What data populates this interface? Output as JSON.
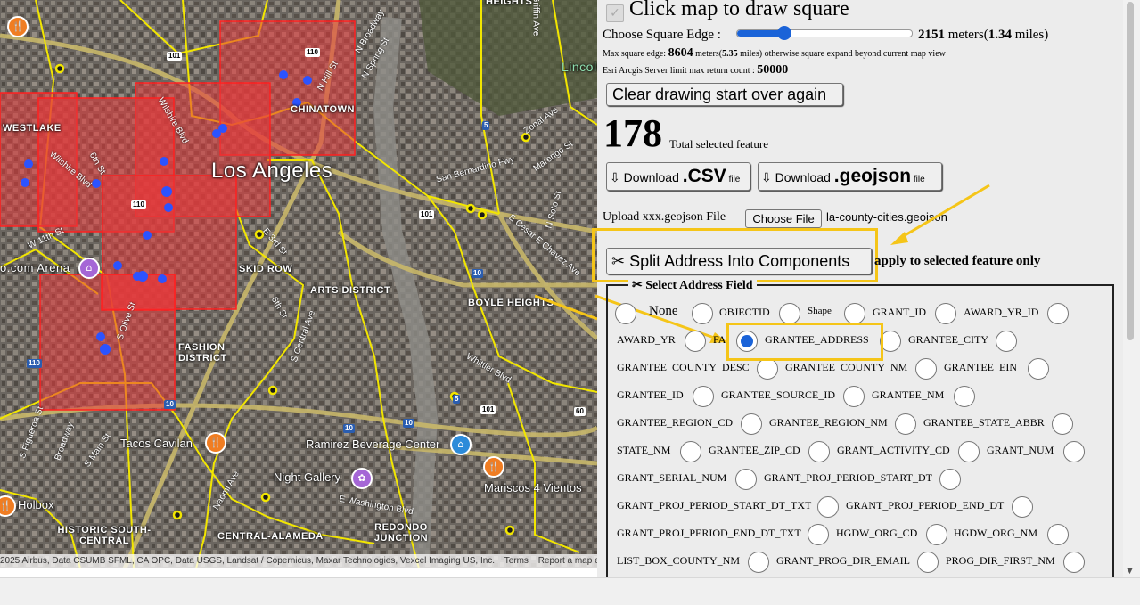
{
  "map": {
    "labels": {
      "heights": "HEIGHTS",
      "westlake": "WESTLAKE",
      "chinatown": "CHINATOWN",
      "los_angeles": "Los Angeles",
      "skid_row": "SKID ROW",
      "arts_district": "ARTS DISTRICT",
      "boyle_heights": "BOYLE HEIGHTS",
      "fashion_district": "FASHION DISTRICT",
      "historic_south_central": "HISTORIC SOUTH-CENTRAL",
      "central_alameda": "CENTRAL-ALAMEDA",
      "redondo_junction": "REDONDO JUNCTION",
      "lincoln": "Lincoln",
      "arena": "o.com Arena"
    },
    "streets": {
      "griffin": "Griffin Ave",
      "broadway": "N Broadway",
      "spring": "N Spring St",
      "hill": "N Hill St",
      "zonal": "Zonal Ave",
      "marengo": "Marengo St",
      "san_bernardino": "San Bernardino Fwy",
      "soto": "N Soto St",
      "cesar": "E Cesar E Chavez Ave",
      "wilshire": "Wilshire Blvd",
      "sixth": "6th St",
      "w11th": "W 11th St",
      "e3rd": "E 3rd St",
      "e6th": "6th St",
      "e4th": "E 4th St",
      "central": "S Central Ave",
      "whittier": "Whittier Blvd",
      "washington": "E Washington Blvd",
      "naomi": "Naomi Ave",
      "broadway_s": "Broadway",
      "main": "S Main St",
      "olive": "S Olive St",
      "figueroa": "S Figueroa St",
      "wilshire2": "Wilshire Blvd"
    },
    "pois": {
      "tacos": "Tacos Cavilan",
      "ramirez": "Ramirez Beverage Center",
      "night_gallery": "Night Gallery",
      "mariscos": "Mariscos 4 Vientos",
      "holbox": "Holbox"
    },
    "shields": [
      "101",
      "110",
      "110",
      "101",
      "10",
      "5",
      "101",
      "10",
      "5",
      "110",
      "60",
      "10",
      "10"
    ],
    "attribution": {
      "text": "2025 Airbus, Data CSUMB SFML, CA OPC, Data USGS, Landsat / Copernicus, Maxar Technologies, Vexcel Imaging US, Inc.",
      "terms": "Terms",
      "report": "Report a map error"
    },
    "colors": {
      "square_fill": "#e8393a",
      "square_stroke": "#ff2020",
      "boundary": "#f2e600",
      "point": "#2c53ff"
    }
  },
  "panel": {
    "click_map_label": "Click map to draw square",
    "square_edge_label": "Choose Square Edge :",
    "square_edge_meters": "2151",
    "meters_word": " meters(",
    "square_edge_miles": "1.34",
    "miles_word": " miles)",
    "slider_fraction": 0.27,
    "max_edge_prefix": "Max square edge: ",
    "max_edge_meters": "8604",
    "max_edge_mid": " meters(",
    "max_edge_miles": "5.35",
    "max_edge_suffix": " miles) otherwise square expand beyond current map view",
    "esri_limit_label": "Esri Arcgis Server limit max return count : ",
    "esri_limit_value": "50000",
    "clear_button": "Clear drawing start over again",
    "total_count": "178",
    "total_label": "Total selected feature",
    "download_csv": {
      "prefix": "⇩ Download ",
      "ext": ".CSV",
      "suffix": " file"
    },
    "download_geojson": {
      "prefix": "⇩ Download ",
      "ext": ".geojson",
      "suffix": " file"
    },
    "upload_label": "Upload xxx.geojson File",
    "choose_file_button": "Choose File",
    "chosen_file": "la-county-cities.geojson",
    "split_button": "✂ Split Address Into Components",
    "apply_note": "apply to selected feature only",
    "select_field_legend": "✂ Select Address Field",
    "selected_field": "GRANTEE_ADDRESS",
    "fields": [
      "None",
      "OBJECTID",
      "Shape",
      "GRANT_ID",
      "AWARD_YR_ID",
      "AWARD_YR",
      "FA",
      "GRANTEE_ADDRESS",
      "GRANTEE_CITY",
      "GRANTEE_COUNTY_DESC",
      "GRANTEE_COUNTY_NM",
      "GRANTEE_EIN",
      "GRANTEE_ID",
      "GRANTEE_SOURCE_ID",
      "GRANTEE_NM",
      "GRANTEE_REGION_CD",
      "GRANTEE_REGION_NM",
      "GRANTEE_STATE_ABBR",
      "STATE_NM",
      "GRANTEE_ZIP_CD",
      "GRANT_ACTIVITY_CD",
      "GRANT_NUM",
      "GRANT_SERIAL_NUM",
      "GRANT_PROJ_PERIOD_START_DT",
      "GRANT_PROJ_PERIOD_START_DT_TXT",
      "GRANT_PROJ_PERIOD_END_DT",
      "GRANT_PROJ_PERIOD_END_DT_TXT",
      "HGDW_ORG_CD",
      "HGDW_ORG_NM",
      "LIST_BOX_COUNTY_NM",
      "GRANT_PROG_DIR_EMAIL",
      "PROG_DIR_FIRST_NM"
    ],
    "colors": {
      "highlight": "#f5c518",
      "radio_selected": "#1a63d8"
    }
  }
}
